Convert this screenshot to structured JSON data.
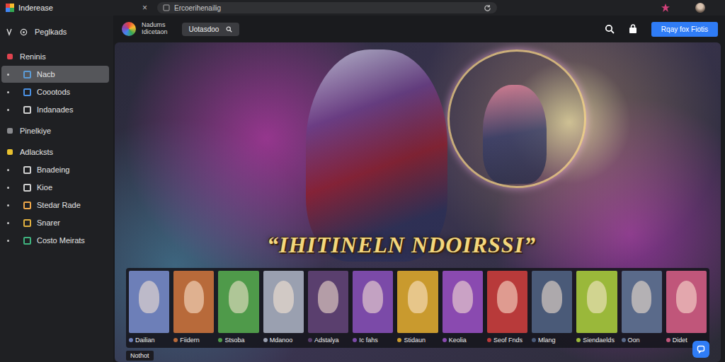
{
  "browser": {
    "tab_title": "Inderease",
    "close": "×",
    "address": "Ercoerihenailig"
  },
  "sidebar": {
    "header": "Peglkads",
    "items": [
      {
        "label": "Reninis",
        "kind": "section",
        "selected": false,
        "color": "#e0434f"
      },
      {
        "label": "Nacb",
        "kind": "item",
        "selected": true,
        "color": "#5b9bd5"
      },
      {
        "label": "Coootods",
        "kind": "item",
        "selected": false,
        "color": "#4a90e2"
      },
      {
        "label": "Indanades",
        "kind": "item",
        "selected": false,
        "color": "#cfcfcf"
      },
      {
        "label": "Pinelkiye",
        "kind": "section",
        "selected": false,
        "color": "#8a8b8f"
      },
      {
        "label": "Adlacksts",
        "kind": "section",
        "selected": false,
        "color": "#e8c12f"
      },
      {
        "label": "Bnadeing",
        "kind": "item",
        "selected": false,
        "color": "#cfcfcf"
      },
      {
        "label": "Kioe",
        "kind": "item",
        "selected": false,
        "color": "#cfcfcf"
      },
      {
        "label": "Stedar Rade",
        "kind": "item",
        "selected": false,
        "color": "#f0a84a"
      },
      {
        "label": "Snarer",
        "kind": "item",
        "selected": false,
        "color": "#e0b040"
      },
      {
        "label": "Costo Meirats",
        "kind": "item",
        "selected": false,
        "color": "#3fb37f"
      }
    ]
  },
  "header": {
    "brand_line1": "Nadums",
    "brand_line2": "Idicetaon",
    "chip": "Uotasdoo",
    "cta": "Rqay fox Fiotis"
  },
  "hero": {
    "title": "“IHITINELN NDOIRSSI”"
  },
  "cards": [
    {
      "name": "Dailian",
      "color": "#6d7fb8"
    },
    {
      "name": "Fiidern",
      "color": "#b86a3a"
    },
    {
      "name": "Stsoba",
      "color": "#4f9a4a"
    },
    {
      "name": "Mdanoo",
      "color": "#9aa0b0"
    },
    {
      "name": "Adstalya",
      "color": "#5a3f6e"
    },
    {
      "name": "Ic fahs",
      "color": "#7b4aa8"
    },
    {
      "name": "Stidaun",
      "color": "#c99a2e"
    },
    {
      "name": "Keolia",
      "color": "#8a4ab0"
    },
    {
      "name": "Seof Fnds",
      "color": "#b83a3a"
    },
    {
      "name": "Mlang",
      "color": "#4a5a78"
    },
    {
      "name": "Siendaelds",
      "color": "#9ab83a"
    },
    {
      "name": "Oon",
      "color": "#5a6a8a"
    },
    {
      "name": "Didet",
      "color": "#c0567a"
    }
  ],
  "caption": "Nothot"
}
